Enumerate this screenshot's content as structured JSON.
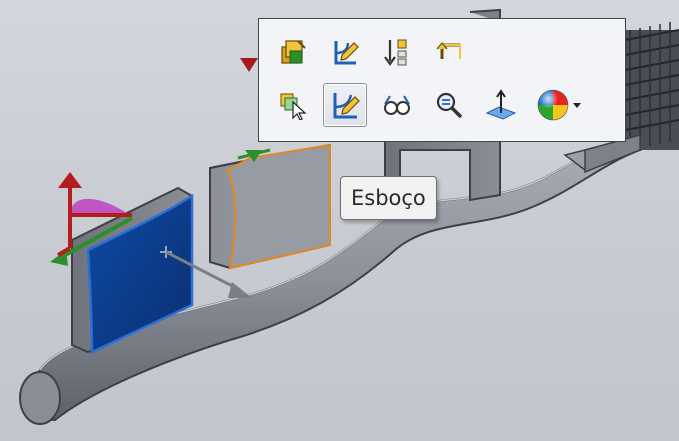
{
  "tooltip": {
    "text": "Esboço"
  },
  "toolbar": {
    "row1": [
      {
        "icon": "edit-feature-icon"
      },
      {
        "icon": "edit-sketch-icon"
      },
      {
        "icon": "rollback-icon"
      },
      {
        "icon": "parent-child-icon"
      }
    ],
    "row2": [
      {
        "icon": "select-other-icon"
      },
      {
        "icon": "sketch-icon",
        "active": true
      },
      {
        "icon": "hide-show-icon"
      },
      {
        "icon": "zoom-to-selection-icon"
      },
      {
        "icon": "normal-to-icon"
      },
      {
        "icon": "appearance-icon"
      }
    ]
  },
  "colors": {
    "accent_blue": "#1f5fb8",
    "selection_blue": "#2b6fd6",
    "orange_edge": "#e3871f",
    "triad_red": "#b51c1c",
    "triad_green": "#2c8f2c",
    "triad_magenta": "#c040c0",
    "model_gray": "#8f939a",
    "face_blue": "#0d3d8c"
  }
}
